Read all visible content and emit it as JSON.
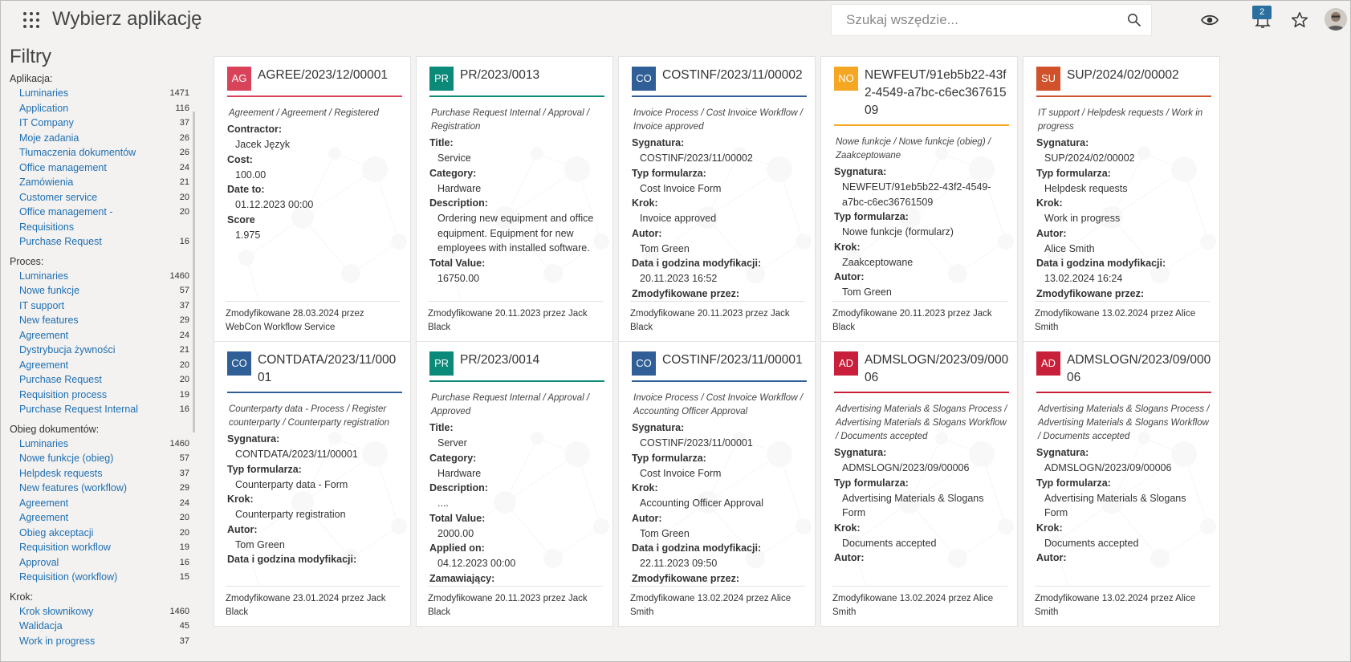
{
  "header": {
    "title": "Wybierz aplikację",
    "search_placeholder": "Szukaj wszędzie...",
    "notification_count": "2"
  },
  "sidebar": {
    "title": "Filtry",
    "groups": [
      {
        "title": "Aplikacja:",
        "items": [
          {
            "label": "Luminaries",
            "count": "1471"
          },
          {
            "label": "Application",
            "count": "116"
          },
          {
            "label": "IT Company",
            "count": "37"
          },
          {
            "label": "Moje zadania",
            "count": "26"
          },
          {
            "label": "Tłumaczenia dokumentów",
            "count": "26"
          },
          {
            "label": "Office management",
            "count": "24"
          },
          {
            "label": "Zamówienia",
            "count": "21"
          },
          {
            "label": "Customer service",
            "count": "20"
          },
          {
            "label": "Office management - Requisitions",
            "count": "20"
          },
          {
            "label": "Purchase Request",
            "count": "16"
          }
        ]
      },
      {
        "title": "Proces:",
        "items": [
          {
            "label": "Luminaries",
            "count": "1460"
          },
          {
            "label": "Nowe funkcje",
            "count": "57"
          },
          {
            "label": "IT support",
            "count": "37"
          },
          {
            "label": "New features",
            "count": "29"
          },
          {
            "label": "Agreement",
            "count": "24"
          },
          {
            "label": "Dystrybucja żywności",
            "count": "21"
          },
          {
            "label": "Agreement",
            "count": "20"
          },
          {
            "label": "Purchase Request",
            "count": "20"
          },
          {
            "label": "Requisition process",
            "count": "19"
          },
          {
            "label": "Purchase Request Internal",
            "count": "16"
          }
        ]
      },
      {
        "title": "Obieg dokumentów:",
        "items": [
          {
            "label": "Luminaries",
            "count": "1460"
          },
          {
            "label": "Nowe funkcje (obieg)",
            "count": "57"
          },
          {
            "label": "Helpdesk requests",
            "count": "37"
          },
          {
            "label": "New features (workflow)",
            "count": "29"
          },
          {
            "label": "Agreement",
            "count": "24"
          },
          {
            "label": "Agreement",
            "count": "20"
          },
          {
            "label": "Obieg akceptacji",
            "count": "20"
          },
          {
            "label": "Requisition workflow",
            "count": "19"
          },
          {
            "label": "Approval",
            "count": "16"
          },
          {
            "label": "Requisition (workflow)",
            "count": "15"
          }
        ]
      },
      {
        "title": "Krok:",
        "items": [
          {
            "label": "Krok słownikowy",
            "count": "1460"
          },
          {
            "label": "Walidacja",
            "count": "45"
          },
          {
            "label": "Work in progress",
            "count": "37"
          }
        ]
      }
    ]
  },
  "colors": {
    "AG": "#d9435a",
    "PR": "#0b8a7a",
    "CO": "#2f5f96",
    "NO": "#f5a623",
    "SU": "#d0512a",
    "AD": "#c8203a"
  },
  "cards": [
    {
      "abbr": "AG",
      "title": "AGREE/2023/12/00001",
      "path": "Agreement / Agreement / Registered",
      "fields": [
        {
          "k": "Contractor:",
          "v": "Jacek Język"
        },
        {
          "k": "Cost:",
          "v": "100.00"
        },
        {
          "k": "Date to:",
          "v": "01.12.2023 00:00"
        },
        {
          "k": "Score",
          "v": "1.975"
        }
      ],
      "footer": "Zmodyfikowane 28.03.2024 przez WebCon Workflow Service"
    },
    {
      "abbr": "PR",
      "title": "PR/2023/0013",
      "path": "Purchase Request Internal / Approval / Registration",
      "fields": [
        {
          "k": "Title:",
          "v": "Service"
        },
        {
          "k": "Category:",
          "v": "Hardware"
        },
        {
          "k": "Description:",
          "v": "Ordering new equipment and office equipment. Equipment for new employees with installed software."
        },
        {
          "k": "Total Value:",
          "v": "16750.00"
        }
      ],
      "footer": "Zmodyfikowane 20.11.2023 przez Jack Black"
    },
    {
      "abbr": "CO",
      "title": "COSTINF/2023/11/00002",
      "path": "Invoice Process / Cost Invoice Workflow / Invoice approved",
      "fields": [
        {
          "k": "Sygnatura:",
          "v": "COSTINF/2023/11/00002"
        },
        {
          "k": "Typ formularza:",
          "v": "Cost Invoice Form"
        },
        {
          "k": "Krok:",
          "v": "Invoice approved"
        },
        {
          "k": "Autor:",
          "v": "Tom Green"
        },
        {
          "k": "Data i godzina modyfikacji:",
          "v": "20.11.2023 16:52"
        },
        {
          "k": "Zmodyfikowane przez:",
          "v": ""
        }
      ],
      "footer": "Zmodyfikowane 20.11.2023 przez Jack Black"
    },
    {
      "abbr": "NO",
      "title": "NEWFEUT/91eb5b22-43f2-4549-a7bc-c6ec36761509",
      "path": "Nowe funkcje / Nowe funkcje (obieg) / Zaakceptowane",
      "fields": [
        {
          "k": "Sygnatura:",
          "v": "NEWFEUT/91eb5b22-43f2-4549-a7bc-c6ec36761509"
        },
        {
          "k": "Typ formularza:",
          "v": "Nowe funkcje (formularz)"
        },
        {
          "k": "Krok:",
          "v": "Zaakceptowane"
        },
        {
          "k": "Autor:",
          "v": "Tom Green"
        }
      ],
      "footer": "Zmodyfikowane 20.11.2023 przez Jack Black"
    },
    {
      "abbr": "SU",
      "title": "SUP/2024/02/00002",
      "path": "IT support / Helpdesk requests / Work in progress",
      "fields": [
        {
          "k": "Sygnatura:",
          "v": "SUP/2024/02/00002"
        },
        {
          "k": "Typ formularza:",
          "v": "Helpdesk requests"
        },
        {
          "k": "Krok:",
          "v": "Work in progress"
        },
        {
          "k": "Autor:",
          "v": "Alice Smith"
        },
        {
          "k": "Data i godzina modyfikacji:",
          "v": "13.02.2024 16:24"
        },
        {
          "k": "Zmodyfikowane przez:",
          "v": ""
        }
      ],
      "footer": "Zmodyfikowane 13.02.2024 przez Alice Smith"
    },
    {
      "abbr": "CO",
      "title": "CONTDATA/2023/11/00001",
      "path": "Counterparty data - Process / Register counterparty / Counterparty registration",
      "fields": [
        {
          "k": "Sygnatura:",
          "v": "CONTDATA/2023/11/00001"
        },
        {
          "k": "Typ formularza:",
          "v": "Counterparty data - Form"
        },
        {
          "k": "Krok:",
          "v": "Counterparty registration"
        },
        {
          "k": "Autor:",
          "v": "Tom Green"
        },
        {
          "k": "Data i godzina modyfikacji:",
          "v": ""
        }
      ],
      "footer": "Zmodyfikowane 23.01.2024 przez Jack Black"
    },
    {
      "abbr": "PR",
      "title": "PR/2023/0014",
      "path": "Purchase Request Internal / Approval / Approved",
      "fields": [
        {
          "k": "Title:",
          "v": "Server"
        },
        {
          "k": "Category:",
          "v": "Hardware"
        },
        {
          "k": "Description:",
          "v": "...."
        },
        {
          "k": "Total Value:",
          "v": "2000.00"
        },
        {
          "k": "Applied on:",
          "v": "04.12.2023 00:00"
        },
        {
          "k": "Zamawiający:",
          "v": ""
        }
      ],
      "footer": "Zmodyfikowane 20.11.2023 przez Jack Black"
    },
    {
      "abbr": "CO",
      "title": "COSTINF/2023/11/00001",
      "path": "Invoice Process / Cost Invoice Workflow / Accounting Officer Approval",
      "fields": [
        {
          "k": "Sygnatura:",
          "v": "COSTINF/2023/11/00001"
        },
        {
          "k": "Typ formularza:",
          "v": "Cost Invoice Form"
        },
        {
          "k": "Krok:",
          "v": "Accounting Officer Approval"
        },
        {
          "k": "Autor:",
          "v": "Tom Green"
        },
        {
          "k": "Data i godzina modyfikacji:",
          "v": "22.11.2023 09:50"
        },
        {
          "k": "Zmodyfikowane przez:",
          "v": ""
        }
      ],
      "footer": "Zmodyfikowane 13.02.2024 przez Alice Smith"
    },
    {
      "abbr": "AD",
      "title": "ADMSLOGN/2023/09/00006",
      "path": "Advertising Materials & Slogans Process / Advertising Materials & Slogans Workflow / Documents accepted",
      "fields": [
        {
          "k": "Sygnatura:",
          "v": "ADMSLOGN/2023/09/00006"
        },
        {
          "k": "Typ formularza:",
          "v": "Advertising Materials & Slogans Form"
        },
        {
          "k": "Krok:",
          "v": "Documents accepted"
        },
        {
          "k": "Autor:",
          "v": ""
        }
      ],
      "footer": "Zmodyfikowane 13.02.2024 przez Alice Smith"
    },
    {
      "abbr": "AD",
      "title": "ADMSLOGN/2023/09/00006",
      "path": "Advertising Materials & Slogans Process / Advertising Materials & Slogans Workflow / Documents accepted",
      "fields": [
        {
          "k": "Sygnatura:",
          "v": "ADMSLOGN/2023/09/00006"
        },
        {
          "k": "Typ formularza:",
          "v": "Advertising Materials & Slogans Form"
        },
        {
          "k": "Krok:",
          "v": "Documents accepted"
        },
        {
          "k": "Autor:",
          "v": ""
        }
      ],
      "footer": "Zmodyfikowane 13.02.2024 przez Alice Smith"
    }
  ]
}
